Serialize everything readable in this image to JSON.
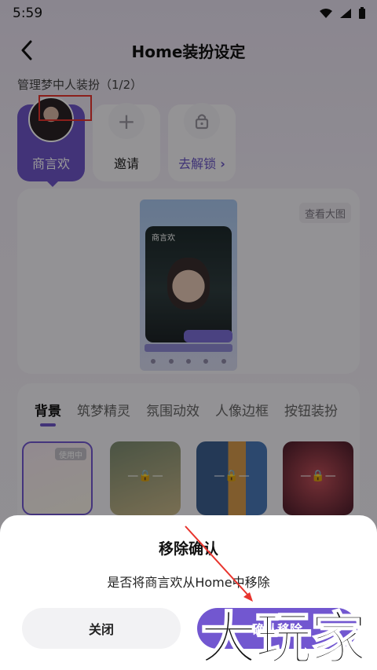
{
  "status_bar": {
    "time": "5:59"
  },
  "header": {
    "title": "Home装扮设定"
  },
  "manage": {
    "label": "管理梦中人装扮（1/2）"
  },
  "slots": [
    {
      "label": "商言欢"
    },
    {
      "label": "邀请",
      "icon": "plus-icon"
    },
    {
      "label": "去解锁",
      "icon": "lock-icon"
    }
  ],
  "preview": {
    "view_large": "查看大图",
    "phone_name": "商言欢"
  },
  "tabs": [
    "背景",
    "筑梦精灵",
    "氛围动效",
    "人像边框",
    "按钮装扮"
  ],
  "thumbnails": [
    {
      "badge": "使用中",
      "lock_text": ""
    },
    {
      "badge": "",
      "lock_text": "—🔒—"
    },
    {
      "badge": "",
      "lock_text": "—🔒—"
    },
    {
      "badge": "",
      "lock_text": "—🔒—"
    }
  ],
  "dialog": {
    "title": "移除确认",
    "message": "是否将商言欢从Home中移除",
    "close_label": "关闭",
    "confirm_label": "确认移除"
  },
  "watermark": "大玩家",
  "colors": {
    "accent": "#6f55c9",
    "annotation": "#e8342d"
  }
}
